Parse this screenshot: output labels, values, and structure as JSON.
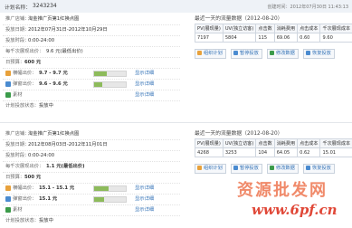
{
  "header": {
    "title_label": "计划名称：",
    "plan_name": "3243234",
    "created_label": "创建时间：",
    "created_value": "2012年07月30日 11:43:13"
  },
  "plans": [
    {
      "rows": {
        "store": {
          "label": "推广店铺：",
          "value": "淘金推广页第1红换点图"
        },
        "period": {
          "label": "投放日期：",
          "value": "2012年07月31日-2012年10月29日"
        },
        "hours": {
          "label": "投放时段：",
          "value": "0:00-24:00"
        },
        "budget": {
          "label": "每千次展现出价：",
          "value": "9.6 元(最低出价)"
        },
        "daily": {
          "label": "日预算：",
          "value": "600 元"
        },
        "b1": {
          "label": "横幅出价：",
          "value": "9.7 - 9.7 元",
          "show": "显示详细"
        },
        "b2": {
          "label": "弹窗出价：",
          "value": "9.6 - 9.6 元",
          "show": "显示详细"
        },
        "b3": {
          "label": "素材",
          "show": "显示详细"
        },
        "status": {
          "label": "计划投放状态：",
          "value": "投放中"
        }
      },
      "progress": [
        0.4,
        0.25
      ],
      "stats": {
        "title": "最近一天的流量数据（2012-08-20）",
        "headers": [
          "PV(展现量)",
          "UV(独立访客)",
          "点击数",
          "消耗费用",
          "点击成本",
          "千次展现成本"
        ],
        "values": [
          "7197",
          "5804",
          "115",
          "69.06",
          "0.60",
          "9.60"
        ],
        "actions": [
          "组织计划",
          "暂停投放",
          "修改数据",
          "恢复投放"
        ]
      }
    },
    {
      "rows": {
        "store": {
          "label": "推广店铺：",
          "value": "淘金推广页第1红换点图"
        },
        "period": {
          "label": "投放日期：",
          "value": "2012年08月03日-2012年11月01日"
        },
        "hours": {
          "label": "投放时段：",
          "value": "0:00-24:00"
        },
        "budget": {
          "label": "每千次展现出价：",
          "value": "1.1 元(最低出价)"
        },
        "daily": {
          "label": "日预算：",
          "value": "500 元"
        },
        "b1": {
          "label": "横幅出价：",
          "value": "15.1 - 15.1 元",
          "show": "显示详细"
        },
        "b2": {
          "label": "弹窗出价：",
          "value": "15.1 元",
          "show": "显示详细"
        },
        "b3": {
          "label": "素材",
          "show": "显示详细"
        },
        "status": {
          "label": "计划投放状态：",
          "value": "投放中"
        }
      },
      "progress": [
        0.45,
        0.3
      ],
      "stats": {
        "title": "最近一天的流量数据（2012-08-20）",
        "headers": [
          "PV(展现量)",
          "UV(独立访客)",
          "点击数",
          "消耗费用",
          "点击成本",
          "千次展现成本"
        ],
        "values": [
          "4268",
          "3253",
          "104",
          "64.05",
          "0.62",
          "15.01"
        ],
        "actions": [
          "组织计划",
          "暂停投放",
          "修改数据",
          "恢复投放"
        ]
      }
    }
  ],
  "watermark": {
    "cn": "资源批发网",
    "url": "www.6pf.cn"
  }
}
